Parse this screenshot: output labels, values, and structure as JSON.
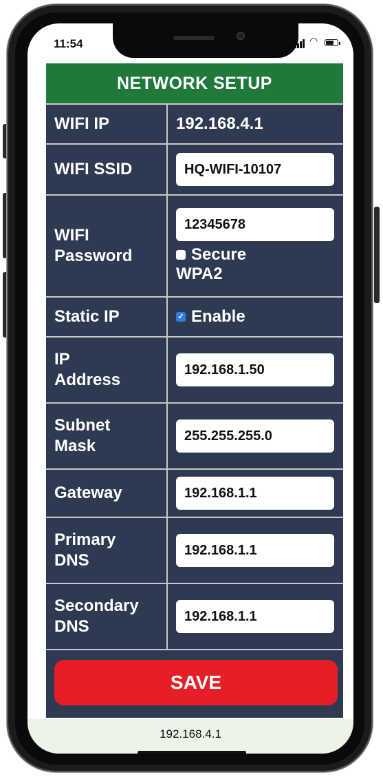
{
  "status_bar": {
    "time": "11:54",
    "signal_icon": "cellular-signal-icon",
    "wifi_icon": "wifi-icon",
    "battery_icon": "battery-icon"
  },
  "form": {
    "title": "NETWORK SETUP",
    "colors": {
      "title_bg": "#1f7a3a",
      "panel_bg": "#2e3a52",
      "save_bg": "#e61e28",
      "checkbox_checked": "#2f7de1"
    },
    "rows": {
      "wifi_ip": {
        "label": "WIFI IP",
        "value": "192.168.4.1"
      },
      "wifi_ssid": {
        "label": "WIFI SSID",
        "value": "HQ-WIFI-10107"
      },
      "wifi_password": {
        "label_line1": "WIFI",
        "label_line2": "Password",
        "value": "12345678",
        "secure_label_line1": "Secure",
        "secure_label_line2": "WPA2",
        "secure_checked": false
      },
      "static_ip": {
        "label": "Static IP",
        "enable_label": "Enable",
        "enabled": true
      },
      "ip_address": {
        "label_line1": "IP",
        "label_line2": "Address",
        "value": "192.168.1.50"
      },
      "subnet_mask": {
        "label_line1": "Subnet",
        "label_line2": "Mask",
        "value": "255.255.255.0"
      },
      "gateway": {
        "label": "Gateway",
        "value": "192.168.1.1"
      },
      "primary_dns": {
        "label_line1": "Primary",
        "label_line2": "DNS",
        "value": "192.168.1.1"
      },
      "secondary_dns": {
        "label_line1": "Secondary",
        "label_line2": "DNS",
        "value": "192.168.1.1"
      }
    },
    "save_label": "SAVE"
  },
  "browser": {
    "url": "192.168.4.1"
  }
}
